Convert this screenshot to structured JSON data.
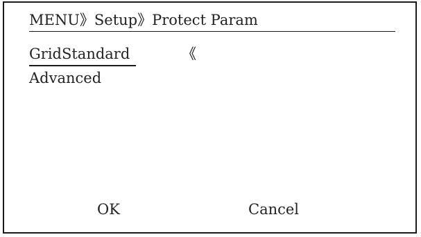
{
  "header": {
    "breadcrumb": "MENU》Setup》Protect Param"
  },
  "menu": {
    "items": [
      {
        "label": "GridStandard",
        "selected": true
      },
      {
        "label": "Advanced",
        "selected": false
      }
    ],
    "cursor_glyph": "《"
  },
  "softkeys": {
    "ok_label": "OK",
    "cancel_label": "Cancel"
  }
}
